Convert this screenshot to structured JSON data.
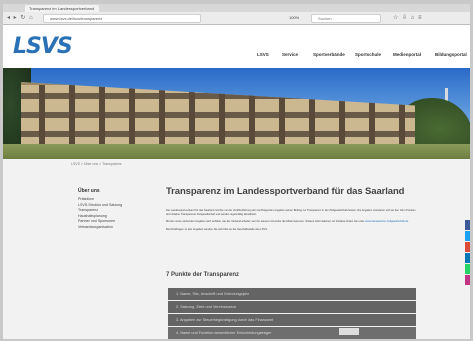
{
  "browser": {
    "tab_title": "Transparenz im Landessportverband",
    "nav_icons": "◂ ▸ ↻ ⌂",
    "url": "www.lsvs.de/lsvs/transparenz",
    "zoom": "100%",
    "search_placeholder": "Suchen",
    "right_icons": "☆ ⇩ ⌂ ≡"
  },
  "site": {
    "logo": "LSVS",
    "nav": [
      "LSVS",
      "Service",
      "Sportverbände",
      "Sportschule",
      "Medienportal",
      "Bildungsportal"
    ]
  },
  "breadcrumb": "LSVS > Über uns > Transparenz",
  "sidebar": {
    "title": "Über uns",
    "items": [
      "Präsidium",
      "LSVS-Struktur und Satzung",
      "Transparenz",
      "Haushaltsplanung",
      "Partner und Sponsoren",
      "Verbandsorganisation"
    ]
  },
  "content": {
    "title": "Transparenz im Landessportverband für das Saarland",
    "paragraph_1": "Der Landessportverband für das Saarland möchte mit der Veröffentlichung der nachfolgenden Angaben seinen Beitrag zur Transparenz in der Zivilgesellschaft leisten. Die Angaben orientieren sich an den zehn Punkten der Initiative Transparente Zivilgesellschaft und werden regelmäßig aktualisiert.",
    "paragraph_2": "Mit den unten stehenden Angaben wird sichtbar, wie der Verband arbeitet, wer ihn steuert und woher die Mittel stammen. Weitere Informationen zur Initiative finden Sie unter",
    "link_text": "www.transparente-zivilgesellschaft.de",
    "paragraph_3": "Bei Rückfragen zu den Angaben wenden Sie sich bitte an die Geschäftsstelle des LSVS.",
    "section_title": "7 Punkte der Transparenz",
    "accordion": [
      "1. Name, Sitz, Anschrift und Gründungsjahr",
      "2. Satzung, Ziele und Vereinszweck",
      "3. Angaben zur Steuerbegünstigung durch das Finanzamt",
      "4. Name und Funktion wesentlicher Entscheidungsträger"
    ]
  },
  "colors": {
    "brand_blue": "#2a72b5",
    "accordion_bg": "#646464",
    "share": [
      "#3b5998",
      "#1da1f2",
      "#dd4b39",
      "#0077b5",
      "#25d366",
      "#c13584"
    ]
  }
}
